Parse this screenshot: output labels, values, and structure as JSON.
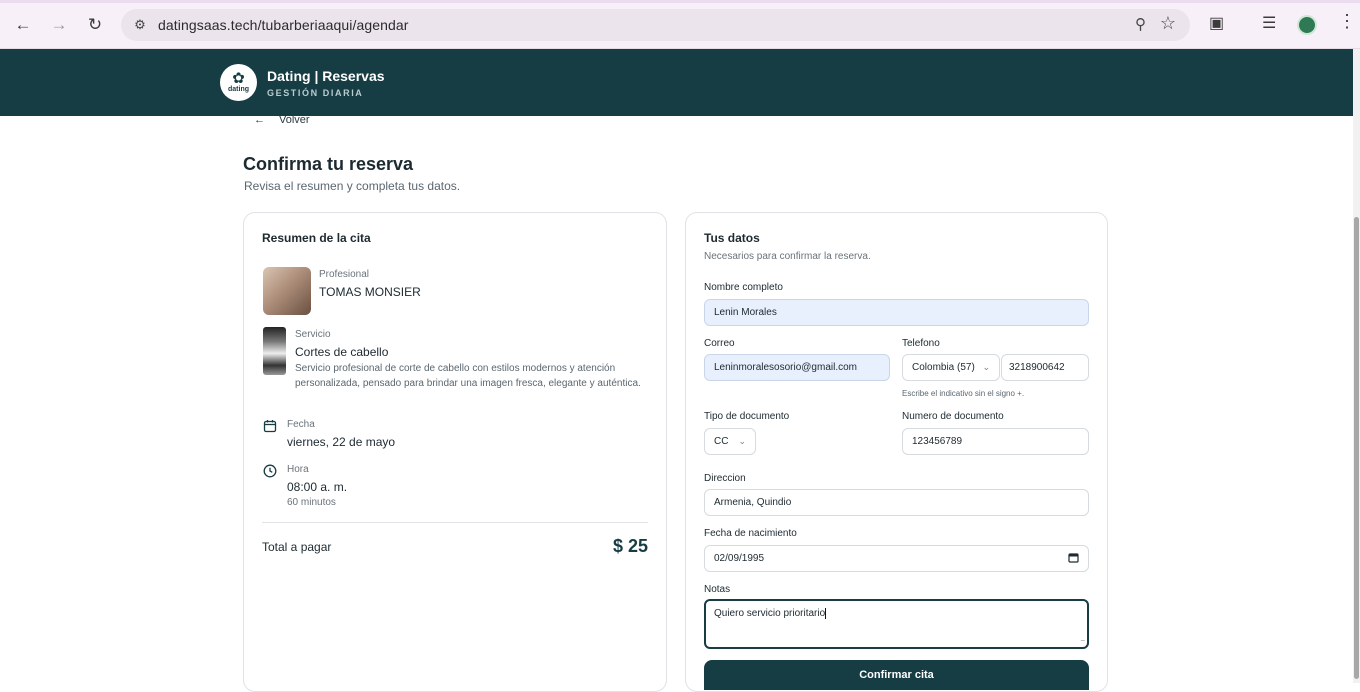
{
  "browser": {
    "url": "datingsaas.tech/tubarberiaaqui/agendar",
    "icons": [
      "back-arrow-icon",
      "forward-arrow-icon",
      "reload-icon",
      "site-settings-icon",
      "zoom-icon",
      "bookmark-star-icon",
      "extensions-icon",
      "media-controls-icon",
      "profile-avatar",
      "menu-kebab-icon"
    ]
  },
  "header": {
    "brand_title": "Dating | Reservas",
    "brand_subtitle": "GESTIÓN DIARIA",
    "logo_word": "dating"
  },
  "page": {
    "back_label": "Volver",
    "title": "Confirma tu reserva",
    "subtitle": "Revisa el resumen y completa tus datos."
  },
  "summary": {
    "title": "Resumen de la cita",
    "professional_label": "Profesional",
    "professional_name": "TOMAS MONSIER",
    "service_label": "Servicio",
    "service_name": "Cortes de cabello",
    "service_description": "Servicio profesional de corte de cabello con estilos modernos y atención personalizada, pensado para brindar una imagen fresca, elegante y auténtica.",
    "date_label": "Fecha",
    "date_value": "viernes, 22 de mayo",
    "time_label": "Hora",
    "time_value": "08:00 a. m.",
    "duration": "60 minutos",
    "total_label": "Total a pagar",
    "total_value": "$ 25"
  },
  "form": {
    "title": "Tus datos",
    "subtitle": "Necesarios para confirmar la reserva.",
    "name_label": "Nombre completo",
    "name_value": "Lenin Morales",
    "email_label": "Correo",
    "email_value": "Leninmoralesosorio@gmail.com",
    "phone_label": "Telefono",
    "country_value": "Colombia (57)",
    "phone_value": "3218900642",
    "phone_hint": "Escribe el indicativo sin el signo +.",
    "doc_type_label": "Tipo de documento",
    "doc_type_value": "CC",
    "doc_number_label": "Numero de documento",
    "doc_number_value": "123456789",
    "address_label": "Direccion",
    "address_value": "Armenia, Quindio",
    "birth_label": "Fecha de nacimiento",
    "birth_value": "02/09/1995",
    "notes_label": "Notas",
    "notes_value": "Quiero servicio prioritario",
    "submit_label": "Confirmar cita"
  },
  "colors": {
    "primary": "#163c44",
    "autofill": "#e8f0fe",
    "border": "#dfe3e6"
  }
}
